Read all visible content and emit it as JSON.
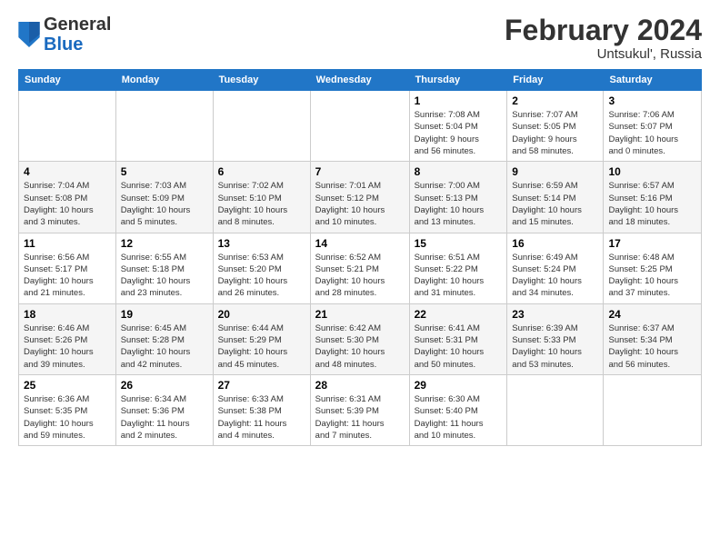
{
  "header": {
    "logo": {
      "general": "General",
      "blue": "Blue"
    },
    "title": "February 2024",
    "location": "Untsukul', Russia"
  },
  "weekdays": [
    "Sunday",
    "Monday",
    "Tuesday",
    "Wednesday",
    "Thursday",
    "Friday",
    "Saturday"
  ],
  "weeks": [
    [
      {
        "day": "",
        "info": ""
      },
      {
        "day": "",
        "info": ""
      },
      {
        "day": "",
        "info": ""
      },
      {
        "day": "",
        "info": ""
      },
      {
        "day": "1",
        "info": "Sunrise: 7:08 AM\nSunset: 5:04 PM\nDaylight: 9 hours\nand 56 minutes."
      },
      {
        "day": "2",
        "info": "Sunrise: 7:07 AM\nSunset: 5:05 PM\nDaylight: 9 hours\nand 58 minutes."
      },
      {
        "day": "3",
        "info": "Sunrise: 7:06 AM\nSunset: 5:07 PM\nDaylight: 10 hours\nand 0 minutes."
      }
    ],
    [
      {
        "day": "4",
        "info": "Sunrise: 7:04 AM\nSunset: 5:08 PM\nDaylight: 10 hours\nand 3 minutes."
      },
      {
        "day": "5",
        "info": "Sunrise: 7:03 AM\nSunset: 5:09 PM\nDaylight: 10 hours\nand 5 minutes."
      },
      {
        "day": "6",
        "info": "Sunrise: 7:02 AM\nSunset: 5:10 PM\nDaylight: 10 hours\nand 8 minutes."
      },
      {
        "day": "7",
        "info": "Sunrise: 7:01 AM\nSunset: 5:12 PM\nDaylight: 10 hours\nand 10 minutes."
      },
      {
        "day": "8",
        "info": "Sunrise: 7:00 AM\nSunset: 5:13 PM\nDaylight: 10 hours\nand 13 minutes."
      },
      {
        "day": "9",
        "info": "Sunrise: 6:59 AM\nSunset: 5:14 PM\nDaylight: 10 hours\nand 15 minutes."
      },
      {
        "day": "10",
        "info": "Sunrise: 6:57 AM\nSunset: 5:16 PM\nDaylight: 10 hours\nand 18 minutes."
      }
    ],
    [
      {
        "day": "11",
        "info": "Sunrise: 6:56 AM\nSunset: 5:17 PM\nDaylight: 10 hours\nand 21 minutes."
      },
      {
        "day": "12",
        "info": "Sunrise: 6:55 AM\nSunset: 5:18 PM\nDaylight: 10 hours\nand 23 minutes."
      },
      {
        "day": "13",
        "info": "Sunrise: 6:53 AM\nSunset: 5:20 PM\nDaylight: 10 hours\nand 26 minutes."
      },
      {
        "day": "14",
        "info": "Sunrise: 6:52 AM\nSunset: 5:21 PM\nDaylight: 10 hours\nand 28 minutes."
      },
      {
        "day": "15",
        "info": "Sunrise: 6:51 AM\nSunset: 5:22 PM\nDaylight: 10 hours\nand 31 minutes."
      },
      {
        "day": "16",
        "info": "Sunrise: 6:49 AM\nSunset: 5:24 PM\nDaylight: 10 hours\nand 34 minutes."
      },
      {
        "day": "17",
        "info": "Sunrise: 6:48 AM\nSunset: 5:25 PM\nDaylight: 10 hours\nand 37 minutes."
      }
    ],
    [
      {
        "day": "18",
        "info": "Sunrise: 6:46 AM\nSunset: 5:26 PM\nDaylight: 10 hours\nand 39 minutes."
      },
      {
        "day": "19",
        "info": "Sunrise: 6:45 AM\nSunset: 5:28 PM\nDaylight: 10 hours\nand 42 minutes."
      },
      {
        "day": "20",
        "info": "Sunrise: 6:44 AM\nSunset: 5:29 PM\nDaylight: 10 hours\nand 45 minutes."
      },
      {
        "day": "21",
        "info": "Sunrise: 6:42 AM\nSunset: 5:30 PM\nDaylight: 10 hours\nand 48 minutes."
      },
      {
        "day": "22",
        "info": "Sunrise: 6:41 AM\nSunset: 5:31 PM\nDaylight: 10 hours\nand 50 minutes."
      },
      {
        "day": "23",
        "info": "Sunrise: 6:39 AM\nSunset: 5:33 PM\nDaylight: 10 hours\nand 53 minutes."
      },
      {
        "day": "24",
        "info": "Sunrise: 6:37 AM\nSunset: 5:34 PM\nDaylight: 10 hours\nand 56 minutes."
      }
    ],
    [
      {
        "day": "25",
        "info": "Sunrise: 6:36 AM\nSunset: 5:35 PM\nDaylight: 10 hours\nand 59 minutes."
      },
      {
        "day": "26",
        "info": "Sunrise: 6:34 AM\nSunset: 5:36 PM\nDaylight: 11 hours\nand 2 minutes."
      },
      {
        "day": "27",
        "info": "Sunrise: 6:33 AM\nSunset: 5:38 PM\nDaylight: 11 hours\nand 4 minutes."
      },
      {
        "day": "28",
        "info": "Sunrise: 6:31 AM\nSunset: 5:39 PM\nDaylight: 11 hours\nand 7 minutes."
      },
      {
        "day": "29",
        "info": "Sunrise: 6:30 AM\nSunset: 5:40 PM\nDaylight: 11 hours\nand 10 minutes."
      },
      {
        "day": "",
        "info": ""
      },
      {
        "day": "",
        "info": ""
      }
    ]
  ]
}
